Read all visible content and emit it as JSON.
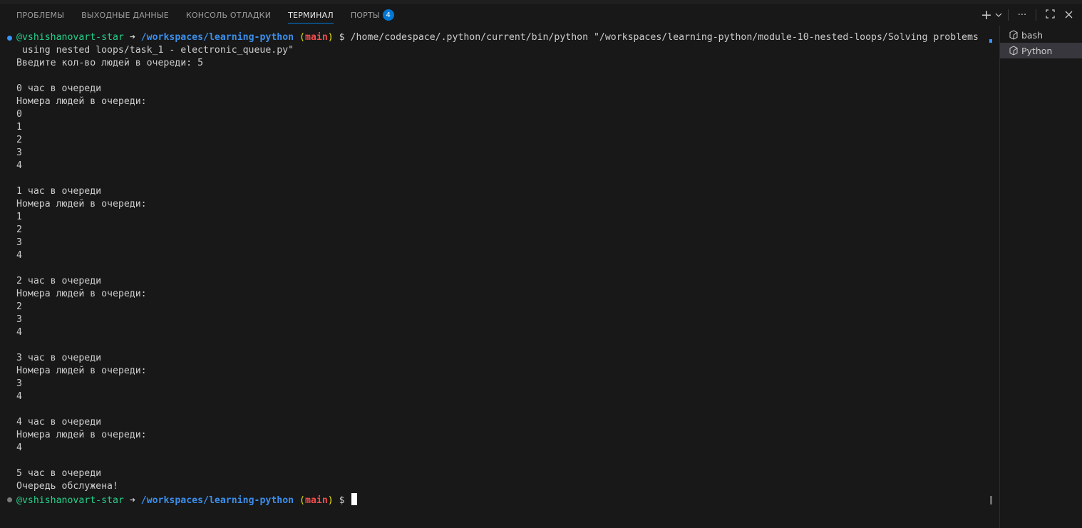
{
  "panel": {
    "tabs": [
      {
        "label": "ПРОБЛЕМЫ"
      },
      {
        "label": "ВЫХОДНЫЕ ДАННЫЕ"
      },
      {
        "label": "КОНСОЛЬ ОТЛАДКИ"
      },
      {
        "label": "ТЕРМИНАЛ"
      },
      {
        "label": "ПОРТЫ",
        "badge": "4"
      }
    ],
    "active_tab": "ТЕРМИНАЛ",
    "actions": [
      {
        "icon": "plus-icon",
        "glyph": "+"
      },
      {
        "icon": "chevron-down-icon",
        "glyph": "⌵"
      },
      {
        "icon": "more-icon",
        "glyph": "···"
      },
      {
        "icon": "maximize-icon",
        "glyph": "⛶"
      },
      {
        "icon": "close-icon",
        "glyph": "✕"
      }
    ]
  },
  "prompt": {
    "user": "@vshishanovart-star",
    "arrow": "➜",
    "path": "/workspaces/learning-python",
    "branch": "main",
    "symbol": "$"
  },
  "terminal": {
    "command": "/home/codespace/.python/current/bin/python \"/workspaces/learning-python/module-10-nested-loops/Solving problems",
    "command_cont": " using nested loops/task_1 - electronic_queue.py\"",
    "output": [
      "Введите кол-во людей в очереди: 5",
      "",
      "0 час в очереди",
      "Номера людей в очереди:",
      "0",
      "1",
      "2",
      "3",
      "4",
      "",
      "1 час в очереди",
      "Номера людей в очереди:",
      "1",
      "2",
      "3",
      "4",
      "",
      "2 час в очереди",
      "Номера людей в очереди:",
      "2",
      "3",
      "4",
      "",
      "3 час в очереди",
      "Номера людей в очереди:",
      "3",
      "4",
      "",
      "4 час в очереди",
      "Номера людей в очереди:",
      "4",
      "",
      "5 час в очереди",
      "Очередь обслужена!"
    ]
  },
  "side_panel": {
    "terminals": [
      {
        "label": "bash",
        "icon": "terminal-icon",
        "selected": false
      },
      {
        "label": "Python",
        "icon": "terminal-icon",
        "selected": true
      }
    ]
  },
  "colors": {
    "accent": "#0078d4",
    "user": "#23d18b",
    "path": "#3b8eea",
    "branch": "#f14c4c"
  }
}
